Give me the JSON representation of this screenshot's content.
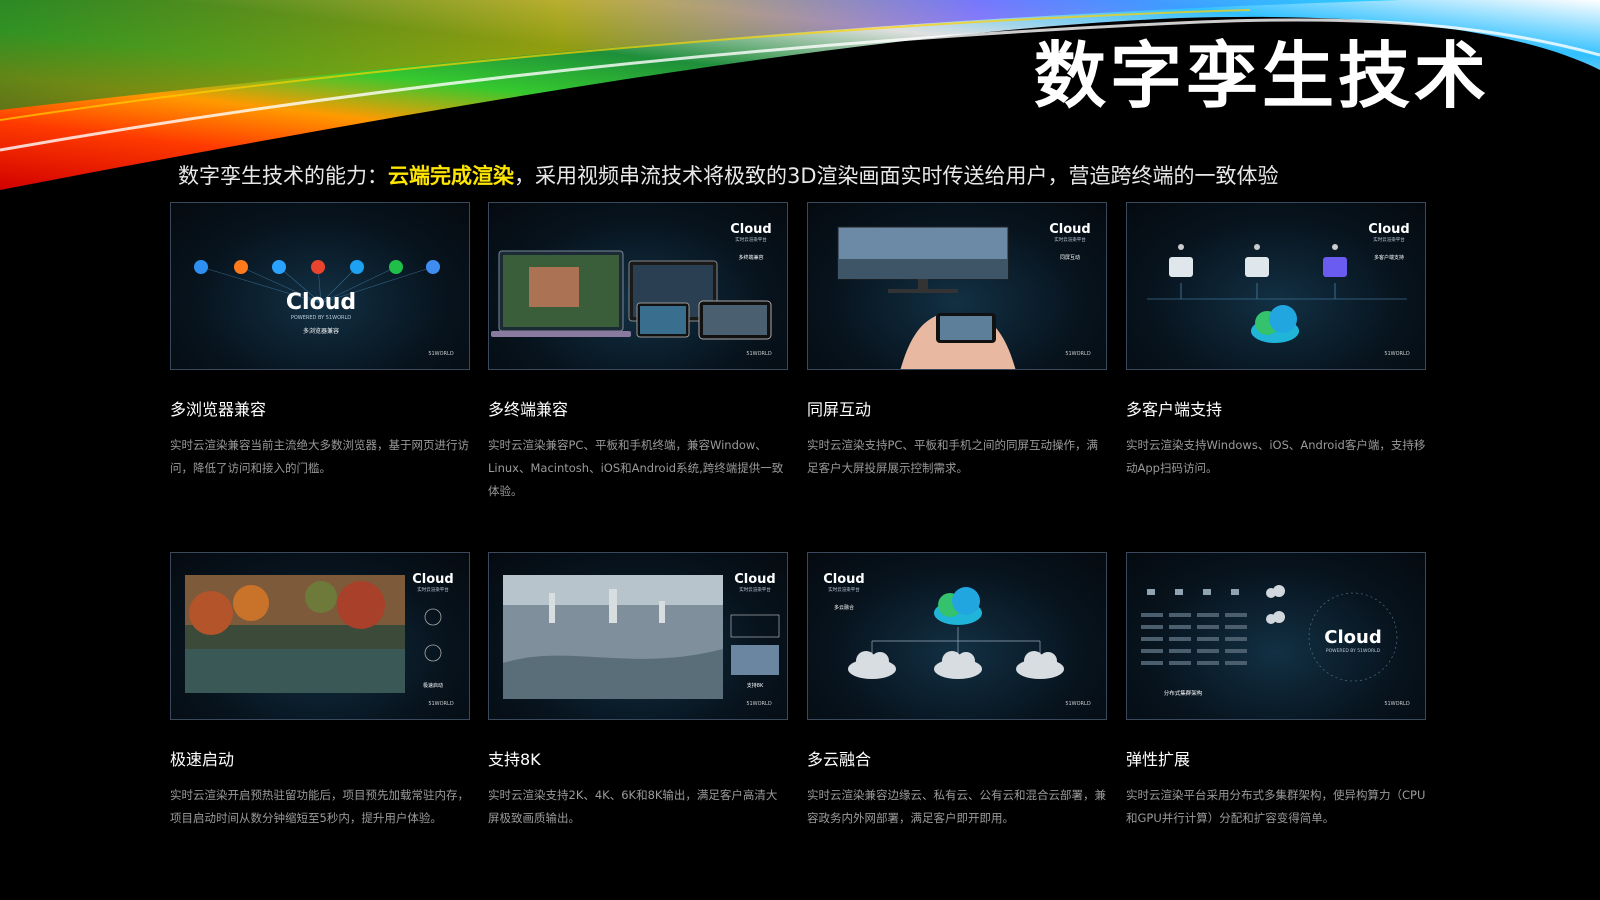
{
  "title": "数字孪生技术",
  "subtitle": {
    "prefix": "数字孪生技术的能力：",
    "highlight": "云端完成渲染",
    "suffix": "，采用视频串流技术将极致的3D渲染画面实时传送给用户，营造跨终端的一致体验"
  },
  "cards": [
    {
      "title": "多浏览器兼容",
      "desc": "实时云渲染兼容当前主流绝大多数浏览器，基于网页进行访问，降低了访问和接入的门槛。",
      "thumb_logo": "Cloud",
      "thumb_sub": "POWERED BY 51WORLD",
      "thumb_caption": "多浏览器兼容"
    },
    {
      "title": "多终端兼容",
      "desc": "实时云渲染兼容PC、平板和手机终端，兼容Window、Linux、Macintosh、iOS和Android系统,跨终端提供一致体验。",
      "thumb_logo": "Cloud",
      "thumb_sub": "实时云渲染平台",
      "thumb_caption": "多终端兼容"
    },
    {
      "title": "同屏互动",
      "desc": "实时云渲染支持PC、平板和手机之间的同屏互动操作，满足客户大屏投屏展示控制需求。",
      "thumb_logo": "Cloud",
      "thumb_sub": "实时云渲染平台",
      "thumb_caption": "同屏互动"
    },
    {
      "title": "多客户端支持",
      "desc": "实时云渲染支持Windows、iOS、Android客户端，支持移动App扫码访问。",
      "thumb_logo": "Cloud",
      "thumb_sub": "实时云渲染平台",
      "thumb_caption": "多客户端支持"
    },
    {
      "title": "极速启动",
      "desc": "实时云渲染开启预热驻留功能后，项目预先加载常驻内存，项目启动时间从数分钟缩短至5秒内，提升用户体验。",
      "thumb_logo": "Cloud",
      "thumb_sub": "实时云渲染平台",
      "thumb_caption": "极速启动"
    },
    {
      "title": "支持8K",
      "desc": "实时云渲染支持2K、4K、6K和8K输出，满足客户高清大屏极致画质输出。",
      "thumb_logo": "Cloud",
      "thumb_sub": "实时云渲染平台",
      "thumb_caption": "支持8K"
    },
    {
      "title": "多云融合",
      "desc": "实时云渲染兼容边缘云、私有云、公有云和混合云部署，兼容政务内外网部署，满足客户即开即用。",
      "thumb_logo": "Cloud",
      "thumb_sub": "实时云渲染平台",
      "thumb_caption": "多云融合"
    },
    {
      "title": "弹性扩展",
      "desc": "实时云渲染平台采用分布式多集群架构，使异构算力（CPU和GPU并行计算）分配和扩容变得简单。",
      "thumb_logo": "Cloud",
      "thumb_sub": "POWERED BY 51WORLD",
      "thumb_caption": "分布式集群架构"
    }
  ],
  "brand": "51WORLD",
  "colors": {
    "highlight": "#ffe600",
    "background": "#000000",
    "thumb_border": "#3a4a5c"
  }
}
